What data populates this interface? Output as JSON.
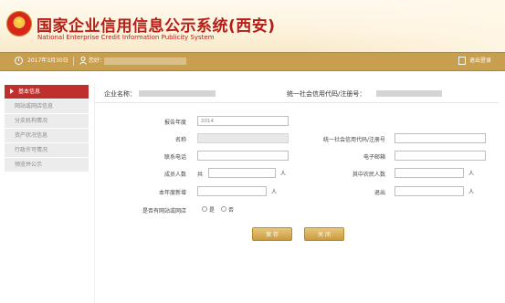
{
  "header": {
    "title_cn": "国家企业信用信息公示系统(西安)",
    "title_en": "National Enterprise Credit Information Publicity System"
  },
  "toolbar": {
    "date": "2017年3月30日",
    "user_label": "您好：",
    "logout_label": "退出登录"
  },
  "sidebar": {
    "items": [
      {
        "label": "基本信息",
        "active": true
      },
      {
        "label": "网站或网店信息",
        "active": false
      },
      {
        "label": "分支机构情况",
        "active": false
      },
      {
        "label": "资产状况信息",
        "active": false
      },
      {
        "label": "行政许可情况",
        "active": false
      },
      {
        "label": "预览并公示",
        "active": false
      }
    ]
  },
  "info": {
    "company_label": "企业名称：",
    "credit_code_label": "统一社会信用代码/注册号："
  },
  "form": {
    "year_label": "报告年度",
    "year_value": "2014",
    "name_label": "名称",
    "code_label": "统一社会信用代码/注册号",
    "phone_label": "联系电话",
    "email_label": "电子邮箱",
    "members_label": "成员人数",
    "members_prefix": "共",
    "unit_person": "人",
    "farmers_label": "其中农民人数",
    "new_label": "本年度新增",
    "exit_label": "退出",
    "website_label": "是否有网站或网店",
    "yes_label": "是",
    "no_label": "否"
  },
  "buttons": {
    "save": "保 存",
    "close": "关 闭"
  },
  "colors": {
    "brand_red": "#b51d17",
    "toolbar_gold": "#c79f4f",
    "active_menu": "#bf2f2b"
  }
}
